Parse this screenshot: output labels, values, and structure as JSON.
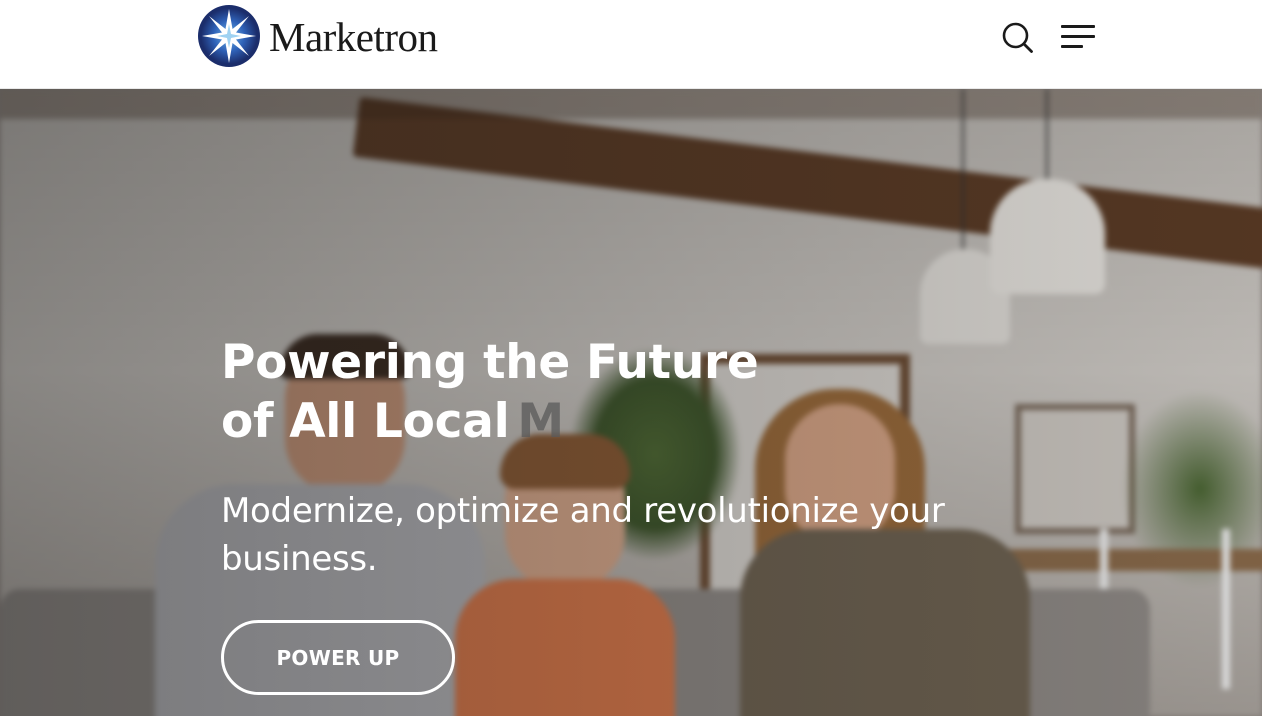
{
  "header": {
    "brand_name": "Marketron",
    "logo_colors": {
      "ring": "#1b2d6b",
      "inner": "#2f62b8",
      "star": "#ffffff",
      "glow": "#9fd2f2"
    },
    "search_icon": "search-icon",
    "menu_icon": "hamburger-menu-icon"
  },
  "hero": {
    "title_line1": "Powering the Future",
    "title_line2": "of All Local",
    "title_typed_fragment": "M",
    "subtitle": "Modernize, optimize and revolutionize your business.",
    "cta_label": "POWER UP",
    "background": "family-laughing-on-couch-photo"
  }
}
